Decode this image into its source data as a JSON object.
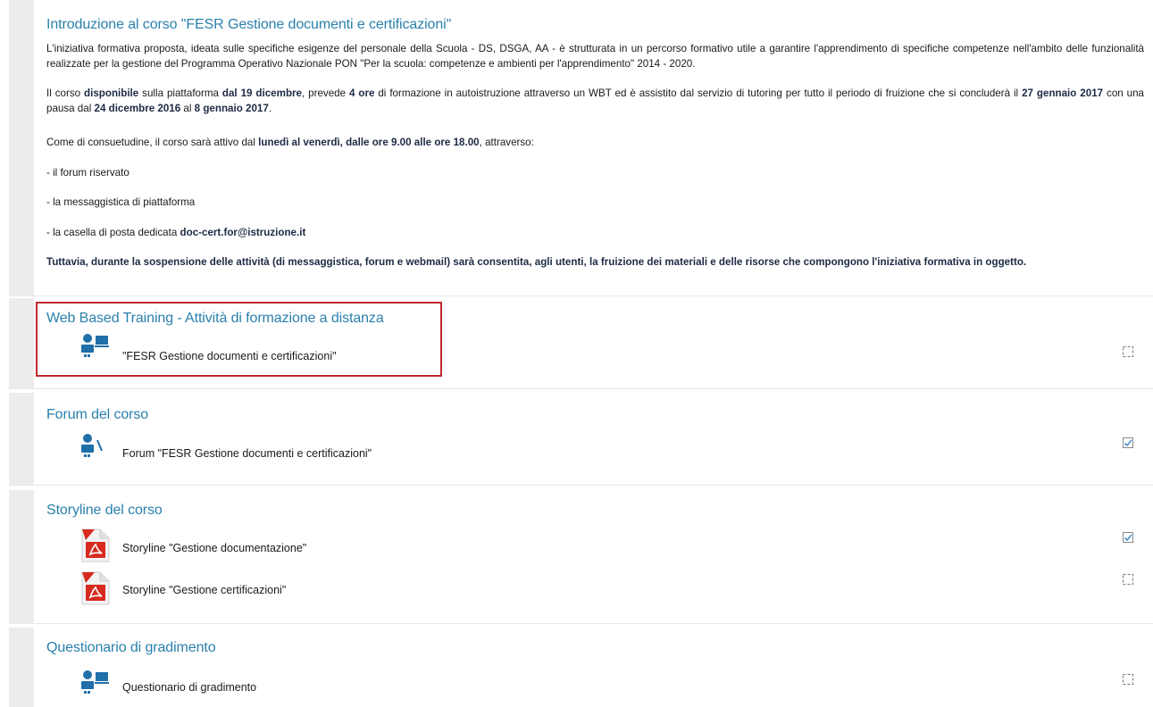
{
  "intro": {
    "title": "Introduzione al corso \"FESR Gestione documenti e certificazioni\"",
    "p1": "L'iniziativa formativa proposta, ideata sulle specifiche esigenze del personale della Scuola - DS, DSGA, AA - è strutturata in un percorso formativo utile a garantire l'apprendimento di specifiche competenze nell'ambito delle funzionalità realizzate per la gestione del Programma Operativo Nazionale PON \"Per la scuola: competenze e ambienti per l'apprendimento\" 2014 - 2020.",
    "p2": {
      "t1": "Il corso ",
      "b1": "disponibile",
      "t2": " sulla piattaforma ",
      "b2": "dal 19 dicembre",
      "t3": ", prevede ",
      "b3": "4 ore",
      "t4": " di formazione in autoistruzione attraverso un WBT ed è assistito dal servizio di tutoring per tutto il periodo di fruizione che si concluderà il ",
      "b4": "27 gennaio 2017",
      "t5": " con una pausa dal ",
      "b5": "24 dicembre 2016",
      "t6": " al ",
      "b6": "8 gennaio 2017",
      "t7": "."
    },
    "p3": {
      "t1": "Come di consuetudine, il corso sarà attivo dal ",
      "b1": "lunedì al venerdì, dalle ore 9.00 alle ore 18.00",
      "t2": ", attraverso:"
    },
    "item1": "- il forum riservato",
    "item2": "- la messaggistica di piattaforma",
    "item3": {
      "t1": "- la casella di posta dedicata ",
      "b1": "doc-cert.for@istruzione.it"
    },
    "p4": "Tuttavia, durante la sospensione delle attività (di messaggistica, forum e webmail) sarà consentita, agli utenti, la fruizione dei materiali e delle risorse che compongono l'iniziativa formativa in oggetto."
  },
  "wbt": {
    "title": "Web Based Training - Attività di formazione a distanza",
    "activities": [
      {
        "label": "\"FESR Gestione documenti e certificazioni\"",
        "icon": "user-screen-icon",
        "completed": false
      }
    ]
  },
  "forum": {
    "title": "Forum del corso",
    "activities": [
      {
        "label": "Forum \"FESR Gestione documenti e certificazioni\"",
        "icon": "forum-user-icon",
        "completed": true
      }
    ]
  },
  "storyline": {
    "title": "Storyline del corso",
    "activities": [
      {
        "label": "Storyline \"Gestione documentazione\"",
        "icon": "pdf-icon",
        "completed": true
      },
      {
        "label": "Storyline \"Gestione certificazioni\"",
        "icon": "pdf-icon",
        "completed": false
      }
    ]
  },
  "questionario": {
    "title": "Questionario di gradimento",
    "activities": [
      {
        "label": "Questionario di gradimento",
        "icon": "user-screen-icon",
        "completed": false
      }
    ]
  },
  "colors": {
    "title_blue": "#2a80ad",
    "highlight_red": "#c0282d",
    "icon_blue": "#1f6fa8",
    "pdf_red": "#d62b1f"
  }
}
